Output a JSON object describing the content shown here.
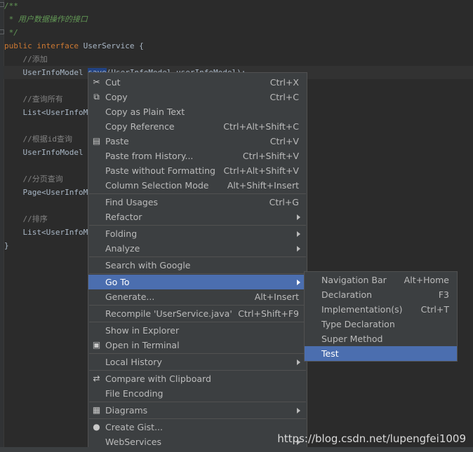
{
  "code": {
    "lines": [
      {
        "text": "/**",
        "cls": "c-doc"
      },
      {
        "text": " * 用户数据操作的接口",
        "cls": "c-doc"
      },
      {
        "text": " */",
        "cls": "c-doc"
      },
      {
        "kw": "public interface ",
        "rest": "UserService {"
      },
      {
        "text": "    //添加",
        "cls": "c-cm"
      },
      {
        "pre": "    UserInfoModel ",
        "sel": "save",
        "post": "(UserInfoModel userInfoModel);"
      },
      {
        "text": ""
      },
      {
        "text": "    //查询所有",
        "cls": "c-cm"
      },
      {
        "text": "    List<UserInfoModel"
      },
      {
        "text": ""
      },
      {
        "text": "    //根据id查询",
        "cls": "c-cm"
      },
      {
        "text": "    UserInfoModel get"
      },
      {
        "text": ""
      },
      {
        "text": "    //分页查询",
        "cls": "c-cm"
      },
      {
        "text": "    Page<UserInfoMod"
      },
      {
        "text": ""
      },
      {
        "text": "    //排序",
        "cls": "c-cm"
      },
      {
        "text": "    List<UserInfoMod"
      },
      {
        "text": "}"
      }
    ]
  },
  "menu": {
    "items": [
      {
        "label": "Cut",
        "shortcut": "Ctrl+X",
        "icon": "scissors-icon",
        "glyph": "✂"
      },
      {
        "label": "Copy",
        "shortcut": "Ctrl+C",
        "icon": "copy-icon",
        "glyph": "⧉"
      },
      {
        "label": "Copy as Plain Text",
        "shortcut": ""
      },
      {
        "label": "Copy Reference",
        "shortcut": "Ctrl+Alt+Shift+C"
      },
      {
        "label": "Paste",
        "shortcut": "Ctrl+V",
        "icon": "clipboard-icon",
        "glyph": "▤"
      },
      {
        "label": "Paste from History...",
        "shortcut": "Ctrl+Shift+V"
      },
      {
        "label": "Paste without Formatting",
        "shortcut": "Ctrl+Alt+Shift+V"
      },
      {
        "label": "Column Selection Mode",
        "shortcut": "Alt+Shift+Insert"
      },
      {
        "sep": true
      },
      {
        "label": "Find Usages",
        "shortcut": "Ctrl+G"
      },
      {
        "label": "Refactor",
        "submenu": true
      },
      {
        "sep": true
      },
      {
        "label": "Folding",
        "submenu": true
      },
      {
        "label": "Analyze",
        "submenu": true
      },
      {
        "sep": true
      },
      {
        "label": "Search with Google",
        "shortcut": ""
      },
      {
        "sep": true
      },
      {
        "label": "Go To",
        "submenu": true,
        "active": true
      },
      {
        "label": "Generate...",
        "shortcut": "Alt+Insert"
      },
      {
        "sep": true
      },
      {
        "label": "Recompile 'UserService.java'",
        "shortcut": "Ctrl+Shift+F9"
      },
      {
        "sep": true
      },
      {
        "label": "Show in Explorer",
        "shortcut": ""
      },
      {
        "label": "Open in Terminal",
        "shortcut": "",
        "icon": "terminal-icon",
        "glyph": "▣"
      },
      {
        "sep": true
      },
      {
        "label": "Local History",
        "submenu": true
      },
      {
        "sep": true
      },
      {
        "label": "Compare with Clipboard",
        "shortcut": "",
        "icon": "compare-icon",
        "glyph": "⇄"
      },
      {
        "label": "File Encoding",
        "shortcut": ""
      },
      {
        "sep": true
      },
      {
        "label": "Diagrams",
        "submenu": true,
        "icon": "diagram-icon",
        "glyph": "▦"
      },
      {
        "sep": true
      },
      {
        "label": "Create Gist...",
        "shortcut": "",
        "icon": "github-icon",
        "glyph": "●"
      },
      {
        "label": "WebServices",
        "submenu": true
      }
    ]
  },
  "submenu": {
    "items": [
      {
        "label": "Navigation Bar",
        "shortcut": "Alt+Home"
      },
      {
        "label": "Declaration",
        "shortcut": "F3"
      },
      {
        "label": "Implementation(s)",
        "shortcut": "Ctrl+T"
      },
      {
        "label": "Type Declaration",
        "shortcut": ""
      },
      {
        "label": "Super Method",
        "shortcut": ""
      },
      {
        "label": "Test",
        "shortcut": "",
        "active": true
      }
    ]
  },
  "watermark": "https://blog.csdn.net/lupengfei1009",
  "colors": {
    "menu_bg": "#3c3f41",
    "selection": "#4b6eaf",
    "editor_bg": "#2b2b2b"
  }
}
